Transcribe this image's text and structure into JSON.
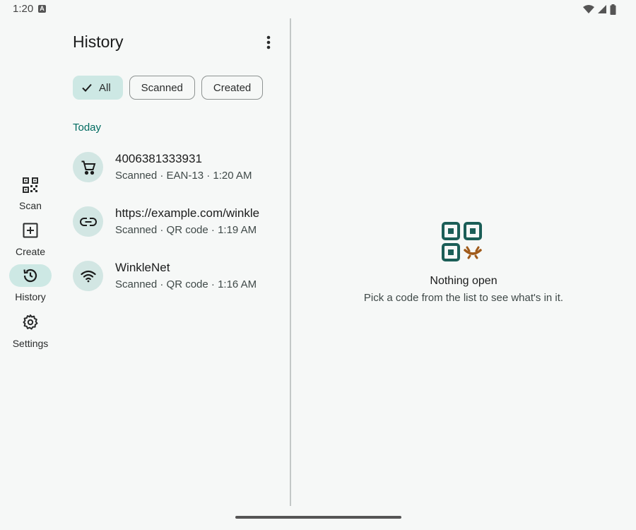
{
  "status": {
    "time": "1:20",
    "notification_letter": "A"
  },
  "rail": {
    "items": [
      {
        "label": "Scan",
        "icon": "qr-scan-icon",
        "active": false
      },
      {
        "label": "Create",
        "icon": "add-box-icon",
        "active": false
      },
      {
        "label": "History",
        "icon": "history-icon",
        "active": true
      },
      {
        "label": "Settings",
        "icon": "gear-icon",
        "active": false
      }
    ]
  },
  "list": {
    "title": "History",
    "chips": [
      {
        "label": "All",
        "selected": true
      },
      {
        "label": "Scanned",
        "selected": false
      },
      {
        "label": "Created",
        "selected": false
      }
    ],
    "section": "Today",
    "items": [
      {
        "title": "4006381333931",
        "subtitle": "Scanned · EAN-13 · 1:20 AM",
        "icon": "cart-icon"
      },
      {
        "title": "https://example.com/winkle",
        "subtitle": "Scanned · QR code · 1:19 AM",
        "icon": "link-icon"
      },
      {
        "title": "WinkleNet",
        "subtitle": "Scanned · QR code · 1:16 AM",
        "icon": "wifi-icon"
      }
    ]
  },
  "detail": {
    "empty_title": "Nothing open",
    "empty_subtitle": "Pick a code from the list to see what's in it."
  },
  "colors": {
    "accent": "#006b60",
    "accent_container": "#cde8e4",
    "illustration_teal": "#1b5e57",
    "illustration_orange": "#a05a1a",
    "background": "#f6f8f7"
  }
}
